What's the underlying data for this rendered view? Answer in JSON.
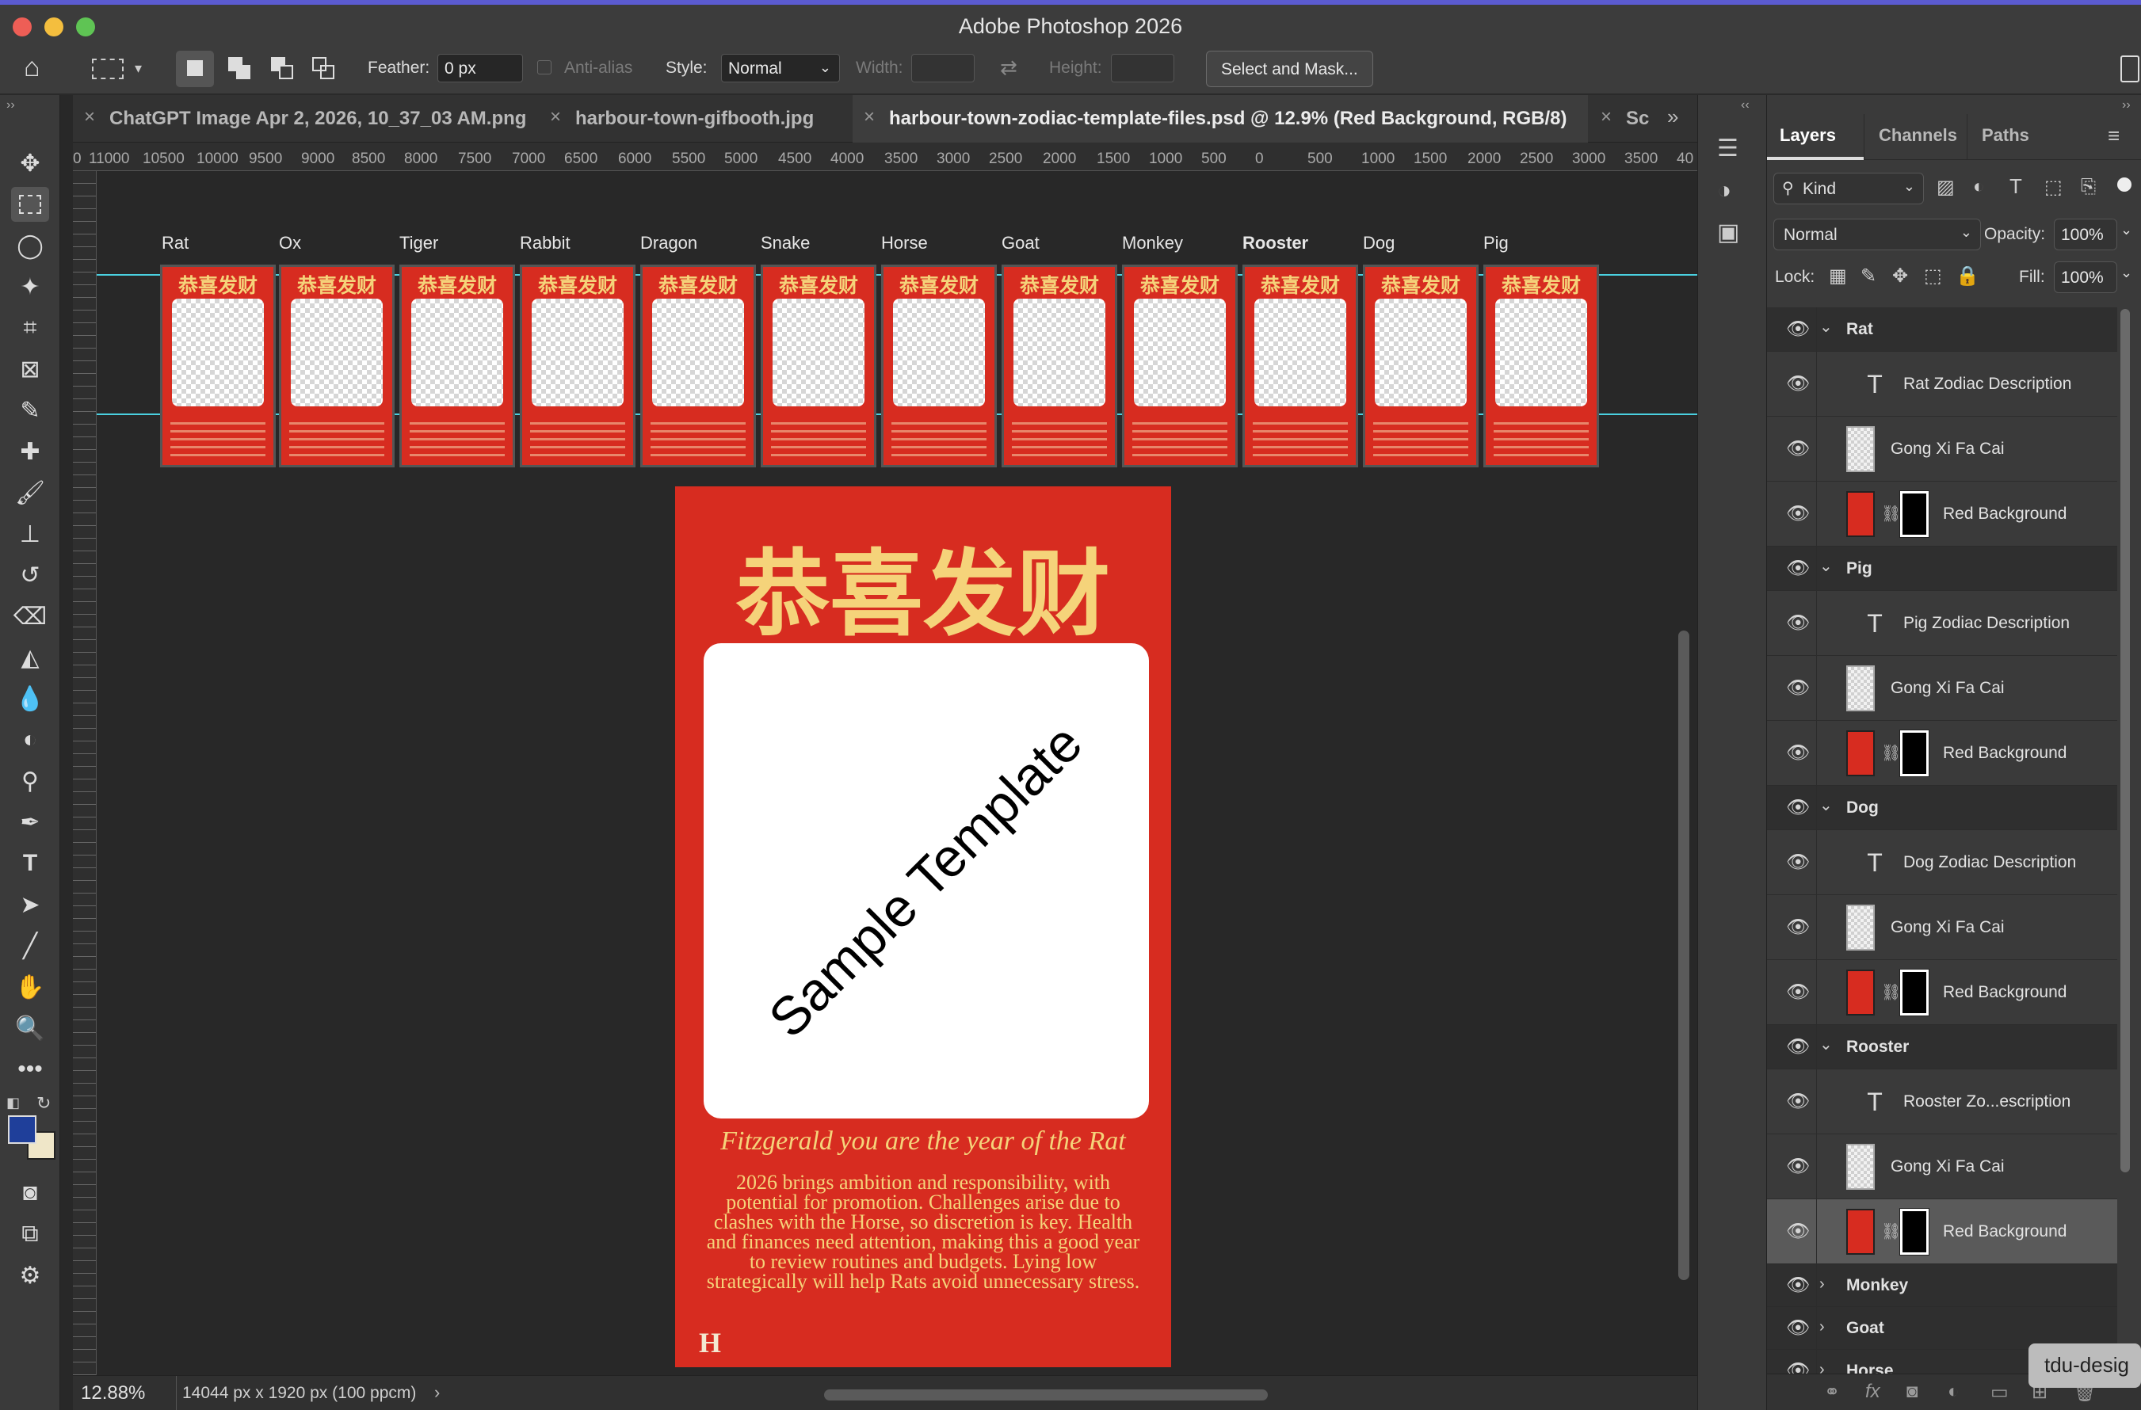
{
  "window": {
    "title": "Adobe Photoshop 2026"
  },
  "options_bar": {
    "feather_label": "Feather:",
    "feather_value": "0 px",
    "antialias_label": "Anti-alias",
    "style_label": "Style:",
    "style_value": "Normal",
    "width_label": "Width:",
    "height_label": "Height:",
    "select_mask_label": "Select and Mask..."
  },
  "tabs": [
    {
      "label": "ChatGPT Image Apr 2, 2026, 10_37_03 AM.png"
    },
    {
      "label": "harbour-town-gifbooth.jpg"
    },
    {
      "label": "harbour-town-zodiac-template-files.psd @ 12.9% (Red Background, RGB/8)"
    },
    {
      "label": "Sc"
    }
  ],
  "ruler_labels": [
    "0",
    "11000",
    "10500",
    "10000",
    "9500",
    "9000",
    "8500",
    "8000",
    "7500",
    "7000",
    "6500",
    "6000",
    "5500",
    "5000",
    "4500",
    "4000",
    "3500",
    "3000",
    "2500",
    "2000",
    "1500",
    "1000",
    "500",
    "0",
    "500",
    "1000",
    "1500",
    "2000",
    "2500",
    "3000",
    "3500",
    "40"
  ],
  "canvas": {
    "zodiac_labels": [
      "Rat",
      "Ox",
      "Tiger",
      "Rabbit",
      "Dragon",
      "Snake",
      "Horse",
      "Goat",
      "Monkey",
      "Rooster",
      "Dog",
      "Pig"
    ],
    "card_heading": "恭喜发财",
    "big_card": {
      "heading": "恭喜发财",
      "watermark": "Sample Template",
      "subtitle": "Fitzgerald you are the year of the Rat",
      "description": "2026 brings ambition and responsibility, with potential for promotion. Challenges arise due to clashes with the Horse, so discretion is key. Health and finances need attention, making this a good year to review routines and budgets. Lying low strategically will help Rats avoid unnecessary stress.",
      "logo": "H"
    }
  },
  "status": {
    "zoom": "12.88%",
    "doc_size": "14044 px x 1920 px (100 ppcm)"
  },
  "layers_panel": {
    "tabs": [
      "Layers",
      "Channels",
      "Paths"
    ],
    "filter": "Kind",
    "blend_mode": "Normal",
    "opacity_label": "Opacity:",
    "opacity_value": "100%",
    "lock_label": "Lock:",
    "fill_label": "Fill:",
    "fill_value": "100%",
    "rows": [
      {
        "kind": "group",
        "name": "Rat",
        "expanded": true
      },
      {
        "kind": "text",
        "name": "Rat Zodiac Description"
      },
      {
        "kind": "pixel",
        "name": "Gong Xi Fa Cai"
      },
      {
        "kind": "masked",
        "name": "Red Background"
      },
      {
        "kind": "group",
        "name": "Pig",
        "expanded": true
      },
      {
        "kind": "text",
        "name": "Pig Zodiac Description"
      },
      {
        "kind": "pixel",
        "name": "Gong Xi Fa Cai"
      },
      {
        "kind": "masked",
        "name": "Red Background"
      },
      {
        "kind": "group",
        "name": "Dog",
        "expanded": true
      },
      {
        "kind": "text",
        "name": "Dog Zodiac Description"
      },
      {
        "kind": "pixel",
        "name": "Gong Xi Fa Cai"
      },
      {
        "kind": "masked",
        "name": "Red Background"
      },
      {
        "kind": "group",
        "name": "Rooster",
        "expanded": true
      },
      {
        "kind": "text",
        "name": "Rooster Zo...escription"
      },
      {
        "kind": "pixel",
        "name": "Gong Xi Fa Cai"
      },
      {
        "kind": "masked",
        "name": "Red Background",
        "selected": true
      },
      {
        "kind": "group",
        "name": "Monkey",
        "expanded": false
      },
      {
        "kind": "group",
        "name": "Goat",
        "expanded": false
      },
      {
        "kind": "group",
        "name": "Horse",
        "expanded": false
      }
    ]
  },
  "tooltip": "tdu-desig",
  "colors": {
    "card_red": "#d72c20",
    "gold": "#f5d37a",
    "guide": "#4ad0e0",
    "foreground": "#1f3f9a",
    "background": "#efe6c8"
  }
}
